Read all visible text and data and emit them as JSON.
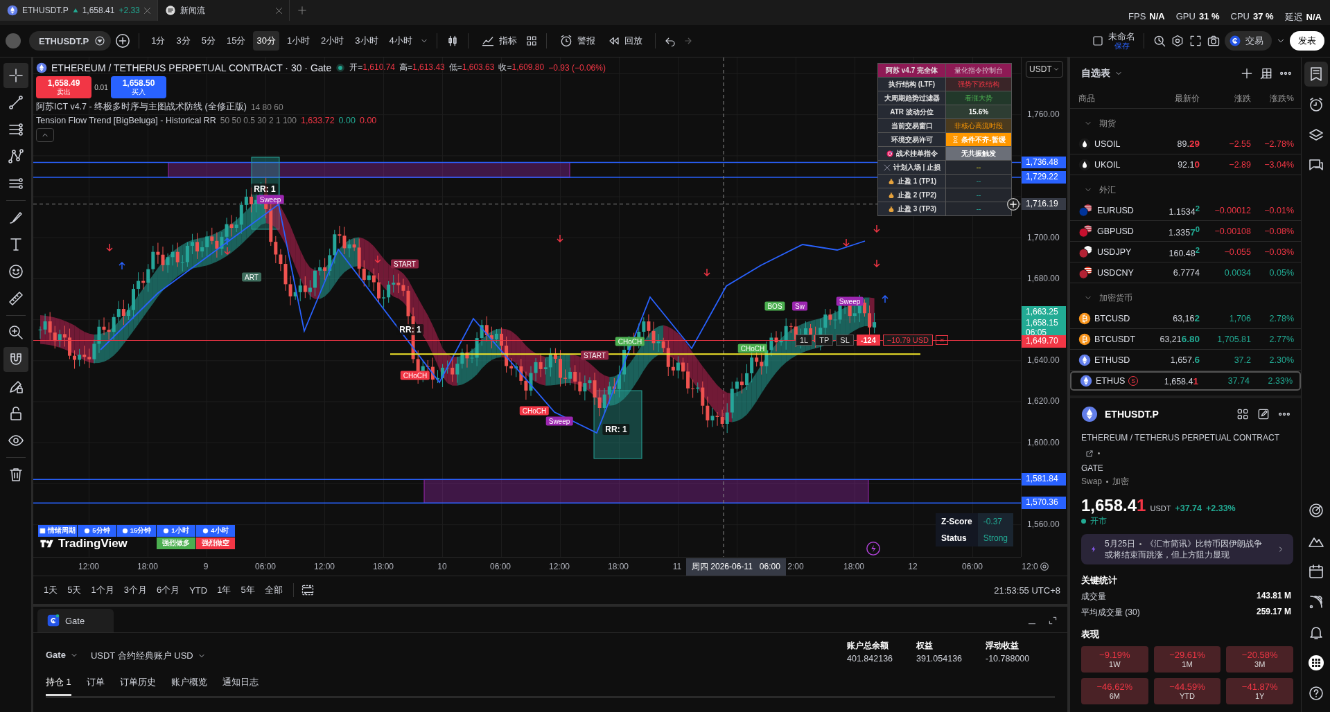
{
  "tabs": [
    {
      "symbol": "ETHUSDT.P",
      "price": "1,658.41",
      "change": "+2.33",
      "selected": true
    },
    {
      "symbol": "新闻流",
      "selected": false
    }
  ],
  "perf": [
    {
      "label": "FPS",
      "value": "N/A"
    },
    {
      "label": "GPU",
      "value": "31 %"
    },
    {
      "label": "CPU",
      "value": "37 %"
    },
    {
      "label": "延迟",
      "value": "N/A"
    }
  ],
  "toolbar": {
    "symbol": "ETHUSDT.P",
    "intervals": [
      {
        "label": "1分",
        "selected": false
      },
      {
        "label": "3分",
        "selected": false
      },
      {
        "label": "5分",
        "selected": false
      },
      {
        "label": "15分",
        "selected": false
      },
      {
        "label": "30分",
        "selected": true
      },
      {
        "label": "1小时",
        "selected": false
      },
      {
        "label": "2小时",
        "selected": false
      },
      {
        "label": "3小时",
        "selected": false
      },
      {
        "label": "4小时",
        "selected": false
      }
    ],
    "indicators": "指标",
    "alerts": "警报",
    "replay": "回放",
    "layout_name": "未命名",
    "layout_status": "保存",
    "trade": "交易",
    "publish": "发表"
  },
  "left_tools": [
    {
      "selected": true
    },
    {
      "selected": false
    },
    {
      "selected": false
    },
    {
      "selected": false
    },
    {
      "selected": false
    },
    {
      "selected": false
    },
    {
      "selected": false
    },
    {
      "selected": false
    },
    {
      "selected": false
    },
    {
      "selected": false
    },
    {
      "selected": true
    },
    {
      "selected": false
    },
    {
      "selected": false
    },
    {
      "selected": false
    },
    {
      "selected": false
    }
  ],
  "chart": {
    "title": "ETHEREUM / TETHERUS PERPETUAL CONTRACT · 30 · Gate",
    "ohlc": [
      {
        "label": "开=",
        "value": "1,610.74"
      },
      {
        "label": "高=",
        "value": "1,613.43"
      },
      {
        "label": "低=",
        "value": "1,603.63"
      },
      {
        "label": "收=",
        "value": "1,609.80"
      }
    ],
    "change": "−0.93 (−0.06%)",
    "sell": {
      "price": "1,658.49",
      "label": "卖出"
    },
    "spread": "0.01",
    "buy": {
      "price": "1,658.50",
      "label": "买入"
    },
    "indicators": [
      {
        "name": "阿苏ICT v4.7 - 终极多时序与主图战术防线 (全修正版)",
        "params": "14 80 60"
      },
      {
        "name": "Tension Flow Trend [BigBeluga] - Historical RR",
        "params": "50 50 0.5 30 2 1 100",
        "values": [
          {
            "text": "1,633.72",
            "color": "#f23645"
          },
          {
            "text": "0.00",
            "color": "#22ab94"
          },
          {
            "text": "0.00",
            "color": "#f23645"
          }
        ]
      }
    ],
    "currency": "USDT",
    "price_ticks": [
      "1,760.00",
      "1,700.00",
      "1,680.00",
      "1,640.00",
      "1,620.00",
      "1,600.00",
      "1,560.00"
    ],
    "price_badges": [
      {
        "text": "1,736.48",
        "color": "#2962ff"
      },
      {
        "text": "1,729.22",
        "color": "#2962ff"
      },
      {
        "text": "1,716.19",
        "color": "#363a45"
      },
      {
        "text": "1,663.25",
        "color": "#22ab94"
      },
      {
        "text": "1,658.15",
        "sub": "06:05",
        "color": "#22ab94"
      },
      {
        "text": "1,649.70",
        "color": "#f23645"
      },
      {
        "text": "1,581.84",
        "color": "#2962ff"
      },
      {
        "text": "1,570.36",
        "color": "#2962ff"
      }
    ],
    "time_ticks": [
      "12:00",
      "18:00",
      "9",
      "06:00",
      "12:00",
      "18:00",
      "10",
      "06:00",
      "12:00",
      "18:00",
      "11",
      "2:00",
      "18:00",
      "12",
      "06:00",
      "12:0"
    ],
    "crosshair_time": "周四 2026-06-11   06:00",
    "labels": [
      {
        "text": "RR: 1",
        "kind": "rr"
      },
      {
        "text": "Sweep",
        "kind": "sweep"
      },
      {
        "text": "ART",
        "kind": "start_bull"
      },
      {
        "text": "START",
        "kind": "start"
      },
      {
        "text": "RR: 1",
        "kind": "rr"
      },
      {
        "text": "CHoCH",
        "kind": "choch_bear"
      },
      {
        "text": "CHoCH",
        "kind": "choch_bear"
      },
      {
        "text": "Sweep",
        "kind": "sweep"
      },
      {
        "text": "START",
        "kind": "start"
      },
      {
        "text": "CHoCH",
        "kind": "choch_bull"
      },
      {
        "text": "RR: 1",
        "kind": "rr"
      },
      {
        "text": "CHoCH",
        "kind": "choch_bull"
      },
      {
        "text": "BOS",
        "kind": "bos"
      },
      {
        "text": "Sweep",
        "kind": "sweep"
      },
      {
        "text": "Sw",
        "kind": "sweep"
      }
    ],
    "position": {
      "qty": "1L",
      "tp": "TP",
      "sl": "SL",
      "pnl": "-124",
      "pnl_usd": "−10.79 USD",
      "close": "×"
    },
    "control_panel": [
      {
        "label": "阿苏 v4.7 完全体",
        "value": "量化指令控制台",
        "kind": "header"
      },
      {
        "label": "执行结构 (LTF)",
        "value": "强势下跌结构",
        "kind": "bear"
      },
      {
        "label": "大周期趋势过滤器",
        "value": "看涨大势",
        "kind": "bull"
      },
      {
        "label": "ATR 波动分位",
        "value": "15.6%",
        "kind": "neutral"
      },
      {
        "label": "当前交易窗口",
        "value": "非核心高流时段",
        "kind": "warn"
      },
      {
        "label": "环境交易许可",
        "value": "条件不齐-暂缓",
        "kind": "alert"
      },
      {
        "label": "战术挂单指令",
        "value": "无共振触发",
        "kind": "plain"
      },
      {
        "label": "计划入场 | 止损",
        "value": "--",
        "kind": "dash_yellow"
      },
      {
        "label": "止盈 1 (TP1)",
        "value": "--",
        "kind": "dash_teal"
      },
      {
        "label": "止盈 2 (TP2)",
        "value": "--",
        "kind": "dash_teal"
      },
      {
        "label": "止盈 3 (TP3)",
        "value": "--",
        "kind": "dash_teal"
      }
    ],
    "legend": {
      "header": [
        "情绪周期",
        "5分钟",
        "15分钟",
        "1小时",
        "4小时"
      ],
      "signals": [
        {
          "text": "强烈做多",
          "kind": "long"
        },
        {
          "text": "强烈做空",
          "kind": "short"
        }
      ]
    },
    "logo": "TradingView",
    "zscore": [
      {
        "label": "Z-Score",
        "value": "-0.37"
      },
      {
        "label": "Status",
        "value": "Strong"
      }
    ]
  },
  "range_bar": {
    "ranges": [
      "1天",
      "5天",
      "1个月",
      "3个月",
      "6个月",
      "YTD",
      "1年",
      "5年",
      "全部"
    ],
    "clock": "21:53:55 UTC+8"
  },
  "gate": {
    "tab": "Gate",
    "broker": "Gate",
    "account": "USDT 合约经典账户 USD",
    "stats": [
      {
        "label": "账户总余额",
        "value": "401.842136"
      },
      {
        "label": "权益",
        "value": "391.054136"
      },
      {
        "label": "浮动收益",
        "value": "-10.788000"
      }
    ],
    "tabs": [
      {
        "label": "持仓 1",
        "selected": true
      },
      {
        "label": "订单",
        "selected": false
      },
      {
        "label": "订单历史",
        "selected": false
      },
      {
        "label": "账户概览",
        "selected": false
      },
      {
        "label": "通知日志",
        "selected": false
      }
    ]
  },
  "watchlist": {
    "title": "自选表",
    "columns": [
      "商品",
      "最新价",
      "涨跌",
      "涨跌%"
    ],
    "groups": [
      {
        "name": "期货",
        "expanded": true,
        "items": [
          {
            "symbol": "USOIL",
            "kind": "oil",
            "price": "89.",
            "price_tail": {
              "text": "29",
              "color": "#f23645"
            },
            "change": "−2.55",
            "change_pct": "−2.78%",
            "color": "#f23645",
            "selected": false
          },
          {
            "symbol": "UKOIL",
            "kind": "oil",
            "price": "92.1",
            "price_tail": {
              "text": "0",
              "color": "#f23645"
            },
            "change": "−2.89",
            "change_pct": "−3.04%",
            "color": "#f23645",
            "selected": false
          }
        ]
      },
      {
        "name": "外汇",
        "expanded": true,
        "items": [
          {
            "symbol": "EURUSD",
            "kind": "eur",
            "price": "1.1534",
            "price_tail": {
              "text": "$^{2}$",
              "color": "#22ab94"
            },
            "change": "−0.00012",
            "change_pct": "−0.01%",
            "color": "#f23645",
            "selected": false
          },
          {
            "symbol": "GBPUSD",
            "kind": "gbp",
            "price": "1.335",
            "price_tail": {
              "text": "7$^{0}$",
              "color": "#22ab94"
            },
            "change": "−0.00108",
            "change_pct": "−0.08%",
            "color": "#f23645",
            "selected": false
          },
          {
            "symbol": "USDJPY",
            "kind": "jpy",
            "price": "160.48",
            "price_tail": {
              "text": "$^{2}$",
              "color": "#22ab94"
            },
            "change": "−0.055",
            "change_pct": "−0.03%",
            "color": "#f23645",
            "selected": false
          },
          {
            "symbol": "USDCNY",
            "kind": "cny",
            "price": "6.7774",
            "change": "0.0034",
            "change_pct": "0.05%",
            "color": "#22ab94",
            "selected": false
          }
        ]
      },
      {
        "name": "加密货币",
        "expanded": true,
        "items": [
          {
            "symbol": "BTCUSD",
            "kind": "btc",
            "price": "63,16",
            "price_tail": {
              "text": "2",
              "color": "#22ab94"
            },
            "change": "1,706",
            "change_pct": "2.78%",
            "color": "#22ab94",
            "selected": false
          },
          {
            "symbol": "BTCUSDT",
            "kind": "btc",
            "price": "63,21",
            "price_tail": {
              "text": "6.80",
              "color": "#22ab94"
            },
            "change": "1,705.81",
            "change_pct": "2.77%",
            "color": "#22ab94",
            "selected": false
          },
          {
            "symbol": "ETHUSD",
            "kind": "eth",
            "price": "1,657.",
            "price_tail": {
              "text": "6",
              "color": "#22ab94"
            },
            "change": "37.2",
            "change_pct": "2.30%",
            "color": "#22ab94",
            "selected": false
          },
          {
            "symbol": "ETHUS",
            "kind": "eth",
            "badge": "S",
            "price": "1,658.4",
            "price_tail": {
              "text": "1",
              "color": "#f23645"
            },
            "change": "37.74",
            "change_pct": "2.33%",
            "color": "#22ab94",
            "selected": true
          }
        ]
      }
    ]
  },
  "details": {
    "symbol": "ETHUSDT.P",
    "description": "ETHEREUM / TETHERUS PERPETUAL CONTRACT",
    "exchange": "GATE",
    "type": "Swap",
    "category": "加密",
    "price": "1,658.4",
    "price_tail": "1",
    "currency": "USDT",
    "change": "+37.74",
    "change_pct": "+2.33%",
    "market_status": "开市",
    "market_open": true,
    "news": {
      "date": "5月25日",
      "text": "《汇市简讯》比特币因伊朗战争或将结束而跳涨，但上方阻力显现"
    },
    "stats_title": "关键统计",
    "stats": [
      {
        "label": "成交量",
        "value": "143.81 M"
      },
      {
        "label": "平均成交量 (30)",
        "value": "259.17 M"
      }
    ],
    "perf_title": "表现",
    "performance": [
      {
        "value": "−9.19%",
        "period": "1W"
      },
      {
        "value": "−29.61%",
        "period": "1M"
      },
      {
        "value": "−20.58%",
        "period": "3M"
      },
      {
        "value": "−46.62%",
        "period": "6M"
      },
      {
        "value": "−44.59%",
        "period": "YTD"
      },
      {
        "value": "−41.87%",
        "period": "1Y"
      }
    ]
  }
}
